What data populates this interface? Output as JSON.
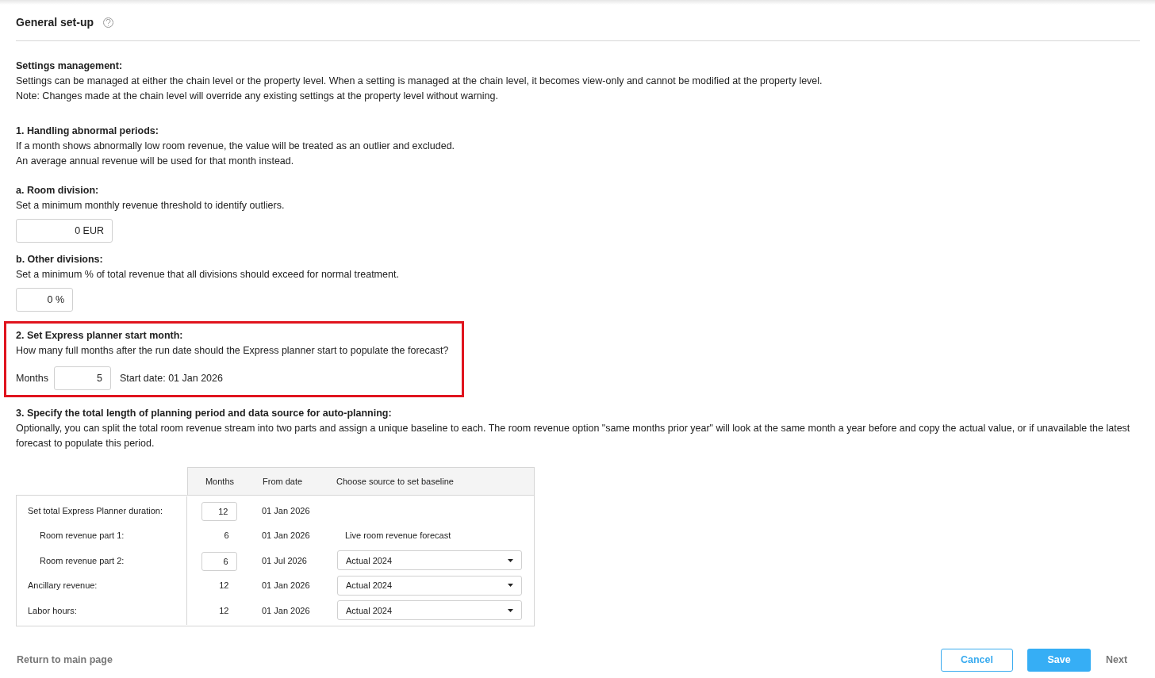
{
  "header": {
    "title": "General set-up"
  },
  "intro": {
    "heading": "Settings management:",
    "lines": [
      "Settings can be managed at either the chain level or the property level. When a setting is managed at the chain level, it becomes view-only and cannot be modified at the property level.",
      "Note: Changes made at the chain level will override any existing settings at the property level without warning."
    ]
  },
  "section_1": {
    "heading": "1.  Handling abnormal periods:",
    "lines": [
      "If a month shows abnormally low room revenue, the value will be treated as an outlier and excluded.",
      "An average annual revenue will be used for that month instead."
    ],
    "subsections": [
      {
        "heading": "a.  Room division:",
        "text": "Set a minimum monthly revenue threshold to identify outliers.",
        "value": "0 EUR",
        "wide": true
      },
      {
        "heading": "b.  Other divisions:",
        "text": "Set a minimum % of total revenue that all divisions should exceed for normal treatment.",
        "value": "0 %",
        "wide": false
      }
    ]
  },
  "section_2": {
    "highlighted": true,
    "heading": "2.  Set Express planner start month:",
    "text": "How many full months after the run date should the Express planner start to populate the forecast?",
    "months_label": "Months",
    "months_value": "5",
    "start_date": "Start date: 01 Jan 2026"
  },
  "section_3": {
    "heading": "3.  Specify the total length of planning period and data source for auto-planning:",
    "text": "Optionally, you can split the total room revenue stream into two parts and assign a unique baseline to each. The room revenue option \"same months prior year\" will look at the same month a year before and copy the actual value, or if unavailable the latest forecast to populate this period.",
    "table": {
      "columns": [
        "Months",
        "From date",
        "Choose source to set baseline"
      ],
      "rows": [
        {
          "label": "Set total Express Planner duration:",
          "months": "12",
          "months_editable": true,
          "from_date": "01 Jan 2026",
          "children": [
            {
              "label": "Room revenue part 1:",
              "months": "6",
              "months_editable": false,
              "from_date": "01 Jan 2026",
              "source": {
                "kind": "text",
                "value": "Live room revenue forecast"
              }
            },
            {
              "label": "Room revenue part 2:",
              "months": "6",
              "months_editable": true,
              "from_date": "01 Jul 2026",
              "source": {
                "kind": "select",
                "value": "Actual 2024"
              }
            }
          ]
        },
        {
          "label": "Ancillary revenue:",
          "months": "12",
          "months_editable": false,
          "from_date": "01 Jan 2026",
          "source": {
            "kind": "select",
            "value": "Actual 2024"
          }
        },
        {
          "label": "Labor hours:",
          "months": "12",
          "months_editable": false,
          "from_date": "01 Jan 2026",
          "source": {
            "kind": "select",
            "value": "Actual 2024"
          }
        }
      ]
    }
  },
  "footer": {
    "back_link": "Return to main page",
    "buttons": [
      {
        "label": "Cancel",
        "kind": "outline"
      },
      {
        "label": "Save",
        "kind": "primary"
      },
      {
        "label": "Next",
        "kind": "text"
      }
    ]
  }
}
